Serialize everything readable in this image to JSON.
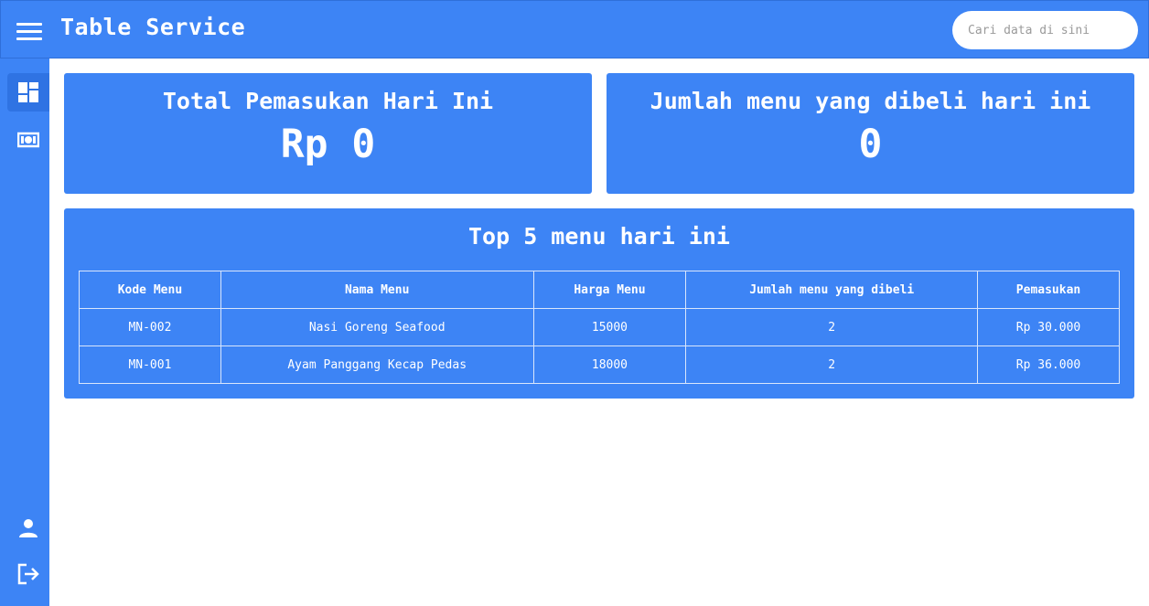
{
  "header": {
    "title": "Table Service",
    "search_placeholder": "Cari data di sini"
  },
  "sidebar": {
    "items": [
      {
        "icon": "dashboard-icon",
        "active": true
      },
      {
        "icon": "money-icon",
        "active": false
      },
      {
        "icon": "person-icon",
        "active": false
      },
      {
        "icon": "logout-icon",
        "active": false
      }
    ]
  },
  "cards": {
    "income": {
      "title": "Total Pemasukan Hari Ini",
      "value": "Rp 0"
    },
    "count": {
      "title": "Jumlah menu yang dibeli hari ini",
      "value": "0"
    }
  },
  "top_menu": {
    "title": "Top 5 menu hari ini",
    "columns": [
      "Kode Menu",
      "Nama Menu",
      "Harga Menu",
      "Jumlah menu yang dibeli",
      "Pemasukan"
    ],
    "rows": [
      [
        "MN-002",
        "Nasi Goreng Seafood",
        "15000",
        "2",
        "Rp 30.000"
      ],
      [
        "MN-001",
        "Ayam Panggang Kecap Pedas",
        "18000",
        "2",
        "Rp 36.000"
      ]
    ]
  },
  "colors": {
    "primary": "#3d84f5",
    "primary_dark": "#2f73e3",
    "text": "#ffffff"
  }
}
